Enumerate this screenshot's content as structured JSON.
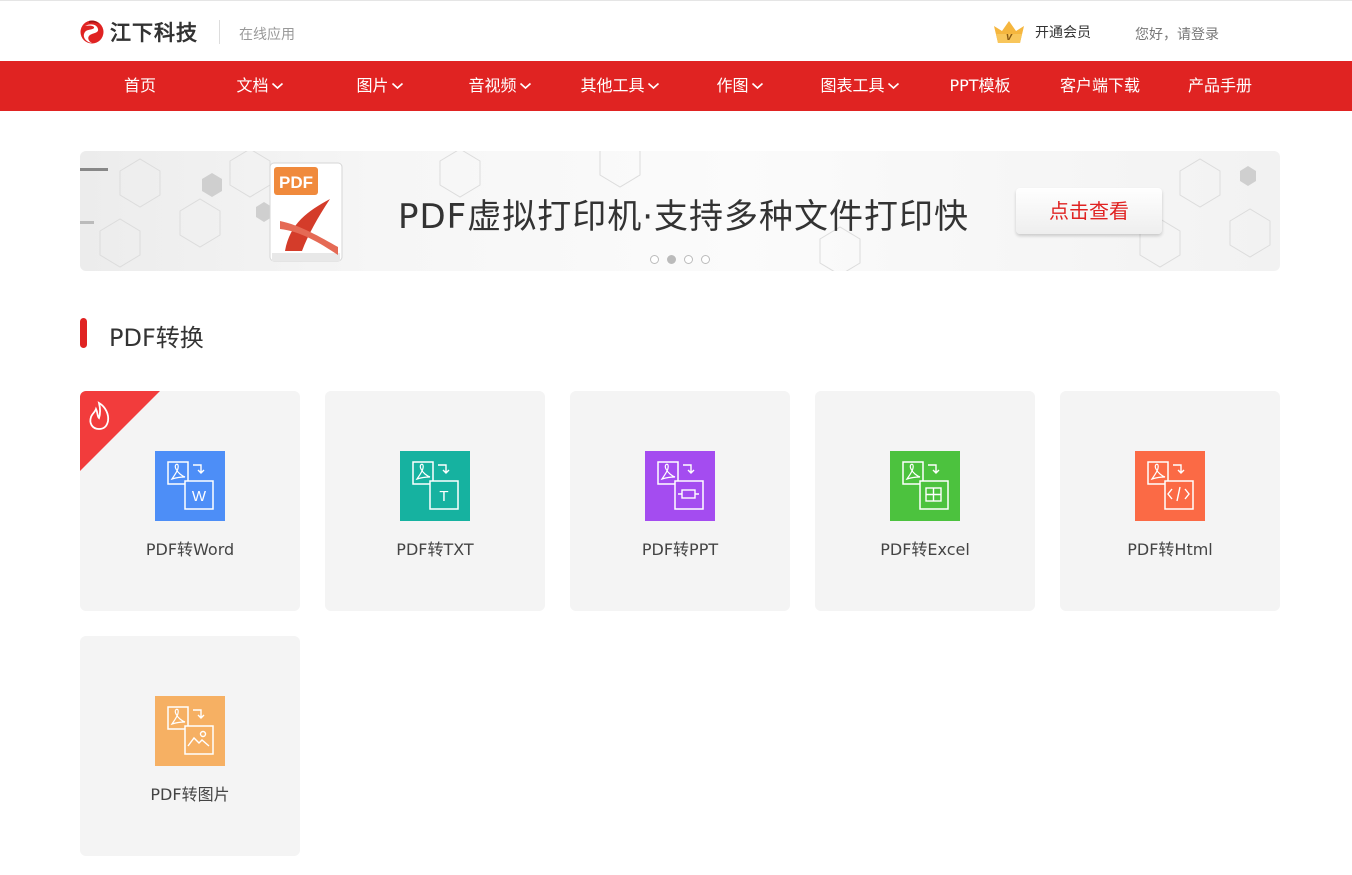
{
  "header": {
    "brand": "江下科技",
    "subtitle": "在线应用",
    "vip_label": "开通会员",
    "login_label": "您好，请登录"
  },
  "nav": {
    "items": [
      {
        "label": "首页",
        "dropdown": false
      },
      {
        "label": "文档",
        "dropdown": true
      },
      {
        "label": "图片",
        "dropdown": true
      },
      {
        "label": "音视频",
        "dropdown": true
      },
      {
        "label": "其他工具",
        "dropdown": true
      },
      {
        "label": "作图",
        "dropdown": true
      },
      {
        "label": "图表工具",
        "dropdown": true
      },
      {
        "label": "PPT模板",
        "dropdown": false
      },
      {
        "label": "客户端下载",
        "dropdown": false
      },
      {
        "label": "产品手册",
        "dropdown": false
      }
    ]
  },
  "banner": {
    "title": "PDF虚拟打印机·支持多种文件打印快",
    "button_label": "点击查看",
    "icon_text": "PDF",
    "slide_count": 4,
    "active_slide": 2
  },
  "section": {
    "title": "PDF转换"
  },
  "tools": [
    {
      "label": "PDF转Word",
      "color": "#4d8ef7",
      "glyph": "W",
      "icon": "pdf-to-word-icon",
      "hot": true
    },
    {
      "label": "PDF转TXT",
      "color": "#16b2a0",
      "glyph": "T",
      "icon": "pdf-to-txt-icon",
      "hot": false
    },
    {
      "label": "PDF转PPT",
      "color": "#a44cf0",
      "glyph": "",
      "icon": "pdf-to-ppt-icon",
      "hot": false
    },
    {
      "label": "PDF转Excel",
      "color": "#4cc23e",
      "glyph": "",
      "icon": "pdf-to-excel-icon",
      "hot": false
    },
    {
      "label": "PDF转Html",
      "color": "#fb6a45",
      "glyph": "",
      "icon": "pdf-to-html-icon",
      "hot": false
    },
    {
      "label": "PDF转图片",
      "color": "#f6b063",
      "glyph": "",
      "icon": "pdf-to-image-icon",
      "hot": false
    }
  ],
  "colors": {
    "brand_red": "#e02322",
    "card_bg": "#f4f4f4",
    "hot_badge": "#f23c3c",
    "crown": "#f5b63e"
  }
}
